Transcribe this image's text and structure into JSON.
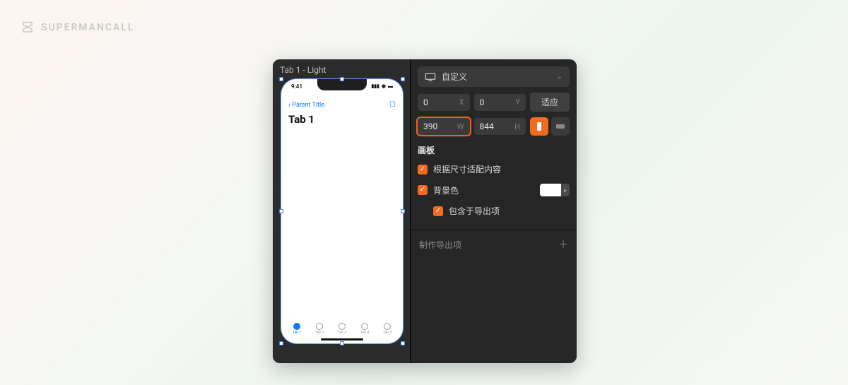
{
  "brand": {
    "name": "SUPERMANCALL"
  },
  "canvas": {
    "artboard_title": "Tab 1 - Light",
    "status_time": "9:41",
    "nav_back": "Parent Title",
    "page_title": "Tab 1",
    "tabs": [
      {
        "label": "Tab 1",
        "active": true
      },
      {
        "label": "Tab 2",
        "active": false
      },
      {
        "label": "Tab 3",
        "active": false
      },
      {
        "label": "Tab 4",
        "active": false
      },
      {
        "label": "Tab 5",
        "active": false
      }
    ]
  },
  "inspector": {
    "device_label": "自定义",
    "x": "0",
    "y": "0",
    "w": "390",
    "h": "844",
    "fit_label": "适应",
    "x_lab": "X",
    "y_lab": "Y",
    "w_lab": "W",
    "h_lab": "H",
    "section_artboard": "画板",
    "check_fit_content": "根据尺寸适配内容",
    "check_bg": "背景色",
    "check_include_export": "包含于导出项",
    "bg_color": "#FFFFFF",
    "section_export": "制作导出项"
  }
}
